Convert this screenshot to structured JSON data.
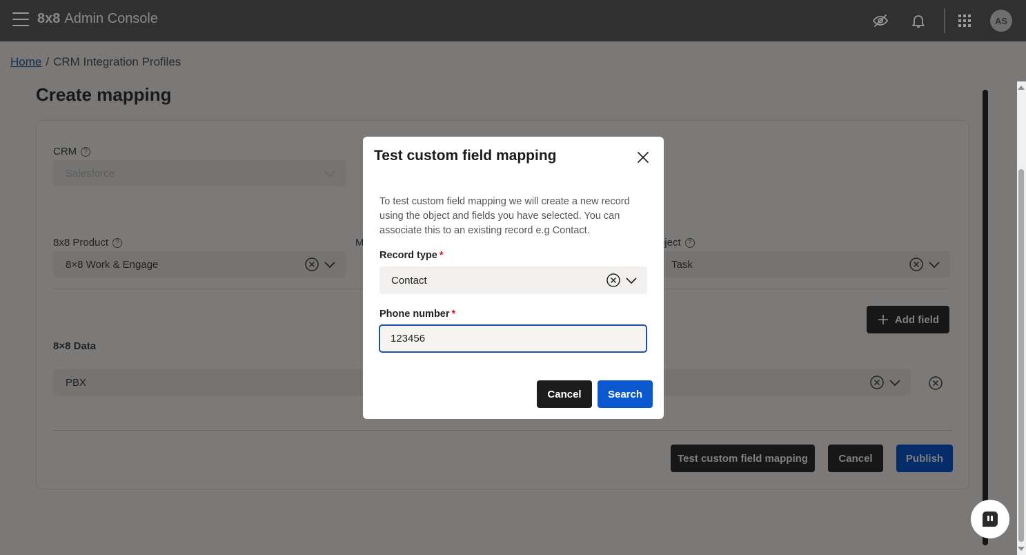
{
  "topbar": {
    "brand_logo": "8x8",
    "brand_name": "Admin Console",
    "icons": [
      "visibility-off-icon",
      "bell-icon",
      "apps-grid-icon"
    ],
    "avatar_initials": "AS"
  },
  "breadcrumb": {
    "home": "Home",
    "separator": "/",
    "current": "CRM Integration Profiles"
  },
  "page": {
    "title": "Create mapping",
    "crm_label": "CRM",
    "crm_value": "Salesforce",
    "product_label": "8x8 Product",
    "product_value": "8×8 Work & Engage",
    "mid_label_fragment": "M",
    "object_label_fragment": "bject",
    "object_value": "Task",
    "add_field_label": "Add field",
    "data_label": "8×8 Data",
    "data_value": "PBX",
    "test_button": "Test custom field mapping",
    "cancel_button": "Cancel",
    "publish_button": "Publish"
  },
  "modal": {
    "title": "Test custom field mapping",
    "description": "To test custom field mapping we will create a new record using the object and fields you have selected. You can associate this to an existing record e.g Contact.",
    "record_type_label": "Record type",
    "record_type_value": "Contact",
    "phone_label": "Phone number",
    "phone_value": "123456",
    "required_marker": "*",
    "cancel_button": "Cancel",
    "search_button": "Search"
  },
  "colors": {
    "topbar": "#303030",
    "primary_blue": "#0b57d0",
    "dark_button": "#2f2f2f",
    "required_red": "#dd1111"
  }
}
